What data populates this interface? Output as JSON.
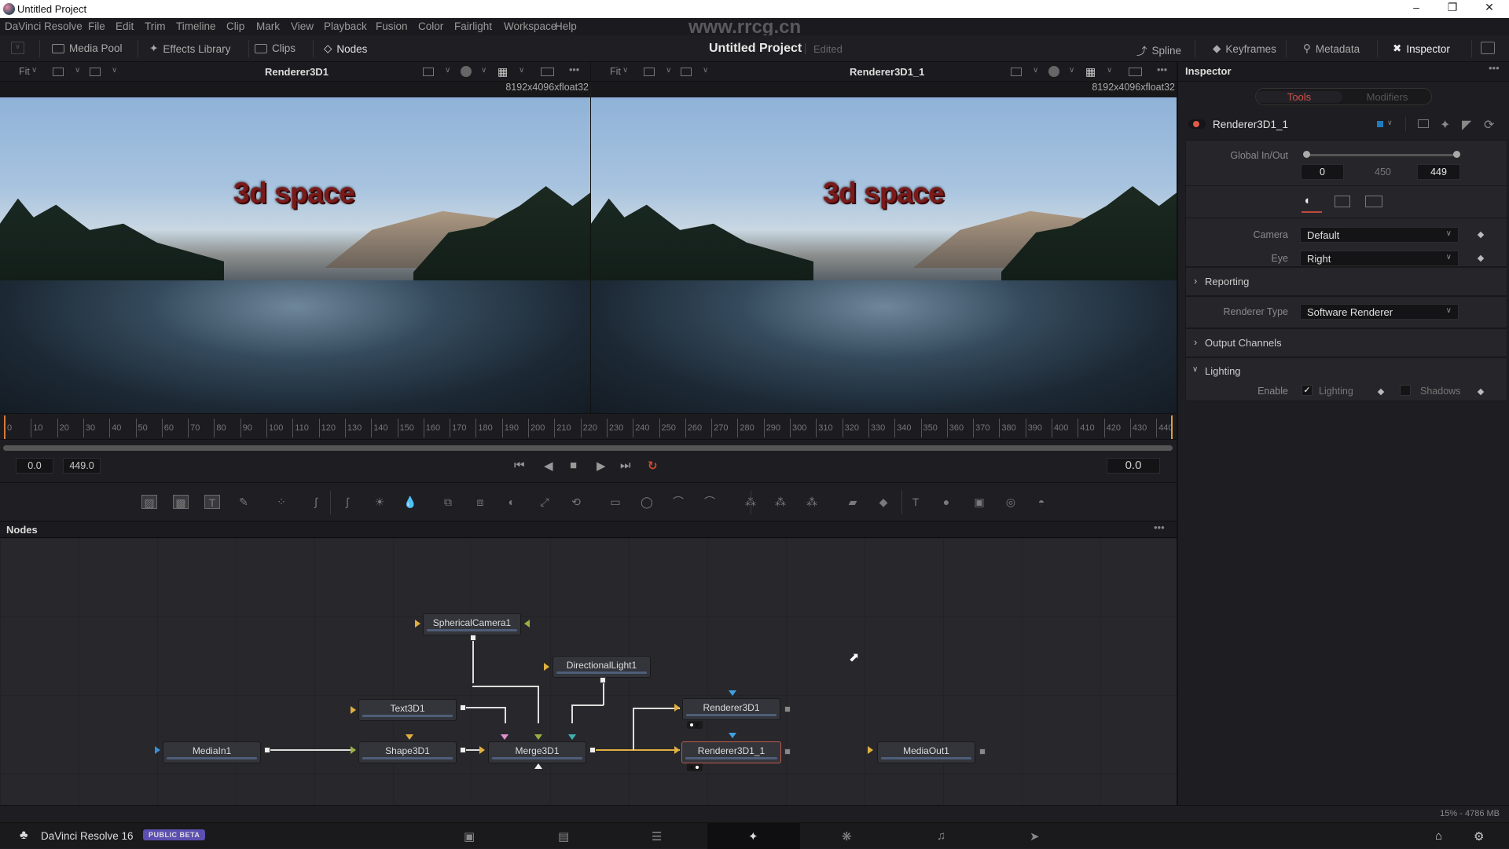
{
  "window": {
    "title": "Untitled Project",
    "controls": [
      "minimize-icon",
      "restore-icon",
      "close-icon"
    ]
  },
  "menu": [
    "DaVinci Resolve",
    "File",
    "Edit",
    "Trim",
    "Timeline",
    "Clip",
    "Mark",
    "View",
    "Playback",
    "Fusion",
    "Color",
    "Fairlight",
    "Workspace",
    "Help"
  ],
  "watermark": "www.rrcg.cn",
  "toolbar": {
    "left": [
      {
        "label": "Media Pool",
        "icon": "media-pool-icon"
      },
      {
        "label": "Effects Library",
        "icon": "effects-wand-icon"
      },
      {
        "label": "Clips",
        "icon": "clips-icon"
      },
      {
        "label": "Nodes",
        "icon": "nodes-icon"
      }
    ],
    "project_title": "Untitled Project",
    "project_status": "Edited",
    "right": [
      {
        "label": "Spline",
        "icon": "spline-icon"
      },
      {
        "label": "Keyframes",
        "icon": "keyframes-icon"
      },
      {
        "label": "Metadata",
        "icon": "metadata-icon"
      },
      {
        "label": "Inspector",
        "icon": "inspector-icon"
      }
    ]
  },
  "viewers": [
    {
      "fit": "Fit",
      "name": "Renderer3D1",
      "resolution": "8192x4096xfloat32",
      "overlay_text": "3d space"
    },
    {
      "fit": "Fit",
      "name": "Renderer3D1_1",
      "resolution": "8192x4096xfloat32",
      "overlay_text": "3d space"
    }
  ],
  "timeline": {
    "ticks": [
      "0",
      "10",
      "20",
      "30",
      "40",
      "50",
      "60",
      "70",
      "80",
      "90",
      "100",
      "110",
      "120",
      "130",
      "140",
      "150",
      "160",
      "170",
      "180",
      "190",
      "200",
      "210",
      "220",
      "230",
      "240",
      "250",
      "260",
      "270",
      "280",
      "290",
      "300",
      "310",
      "320",
      "330",
      "340",
      "350",
      "360",
      "370",
      "380",
      "390",
      "400",
      "410",
      "420",
      "430",
      "440"
    ],
    "start": "0.0",
    "end": "449.0",
    "current": "0.0",
    "range_start": 0,
    "range_end": 449
  },
  "transport": [
    "skip-to-start-icon",
    "play-reverse-icon",
    "stop-icon",
    "play-icon",
    "skip-to-end-icon",
    "loop-icon"
  ],
  "tools": [
    "background-icon",
    "fast-noise-icon",
    "text-icon",
    "paint-icon",
    "particles-icon",
    "color-curves-icon",
    "color-corrector-icon",
    "brightness-contrast-icon",
    "blur-icon",
    "merge-icon",
    "channel-boolean-icon",
    "matte-control-icon",
    "resize-icon",
    "transform-icon",
    "rectangle-mask-icon",
    "ellipse-mask-icon",
    "polygon-mask-icon",
    "bspline-mask-icon",
    "particle-emitter-icon",
    "particle-render-icon",
    "particle-merge-icon",
    "image-plane-icon",
    "shape3d-icon",
    "text3d-icon",
    "merge3d-icon",
    "camera3d-icon",
    "light-icon",
    "renderer3d-icon"
  ],
  "nodes_panel": {
    "title": "Nodes",
    "nodes": [
      {
        "id": "SphericalCamera1",
        "label": "SphericalCamera1"
      },
      {
        "id": "DirectionalLight1",
        "label": "DirectionalLight1"
      },
      {
        "id": "Text3D1",
        "label": "Text3D1"
      },
      {
        "id": "MediaIn1",
        "label": "MediaIn1"
      },
      {
        "id": "Shape3D1",
        "label": "Shape3D1"
      },
      {
        "id": "Merge3D1",
        "label": "Merge3D1"
      },
      {
        "id": "Renderer3D1",
        "label": "Renderer3D1"
      },
      {
        "id": "Renderer3D1_1",
        "label": "Renderer3D1_1",
        "selected": true
      },
      {
        "id": "MediaOut1",
        "label": "MediaOut1"
      }
    ]
  },
  "inspector": {
    "title": "Inspector",
    "tabs": [
      {
        "label": "Tools",
        "active": true
      },
      {
        "label": "Modifiers",
        "active": false
      }
    ],
    "tool_name": "Renderer3D1_1",
    "tool_color": "#1e7bbf",
    "global_in_out": {
      "label": "Global In/Out",
      "in": "0",
      "duration": "450",
      "out": "449"
    },
    "camera": {
      "label": "Camera",
      "value": "Default"
    },
    "eye": {
      "label": "Eye",
      "value": "Right"
    },
    "reporting": "Reporting",
    "renderer_type": {
      "label": "Renderer Type",
      "value": "Software Renderer"
    },
    "output_channels": "Output Channels",
    "lighting": {
      "title": "Lighting",
      "enable_label": "Enable",
      "lighting_label": "Lighting",
      "lighting_checked": true,
      "shadows_label": "Shadows",
      "shadows_checked": false
    }
  },
  "status": {
    "memory": "15% - 4786 MB"
  },
  "bottom": {
    "app_name": "DaVinci Resolve 16",
    "badge": "PUBLIC BETA",
    "pages": [
      "media-icon",
      "cut-icon",
      "edit-icon",
      "fusion-icon",
      "color-icon",
      "fairlight-icon",
      "deliver-icon"
    ],
    "active_page": "fusion-icon"
  }
}
